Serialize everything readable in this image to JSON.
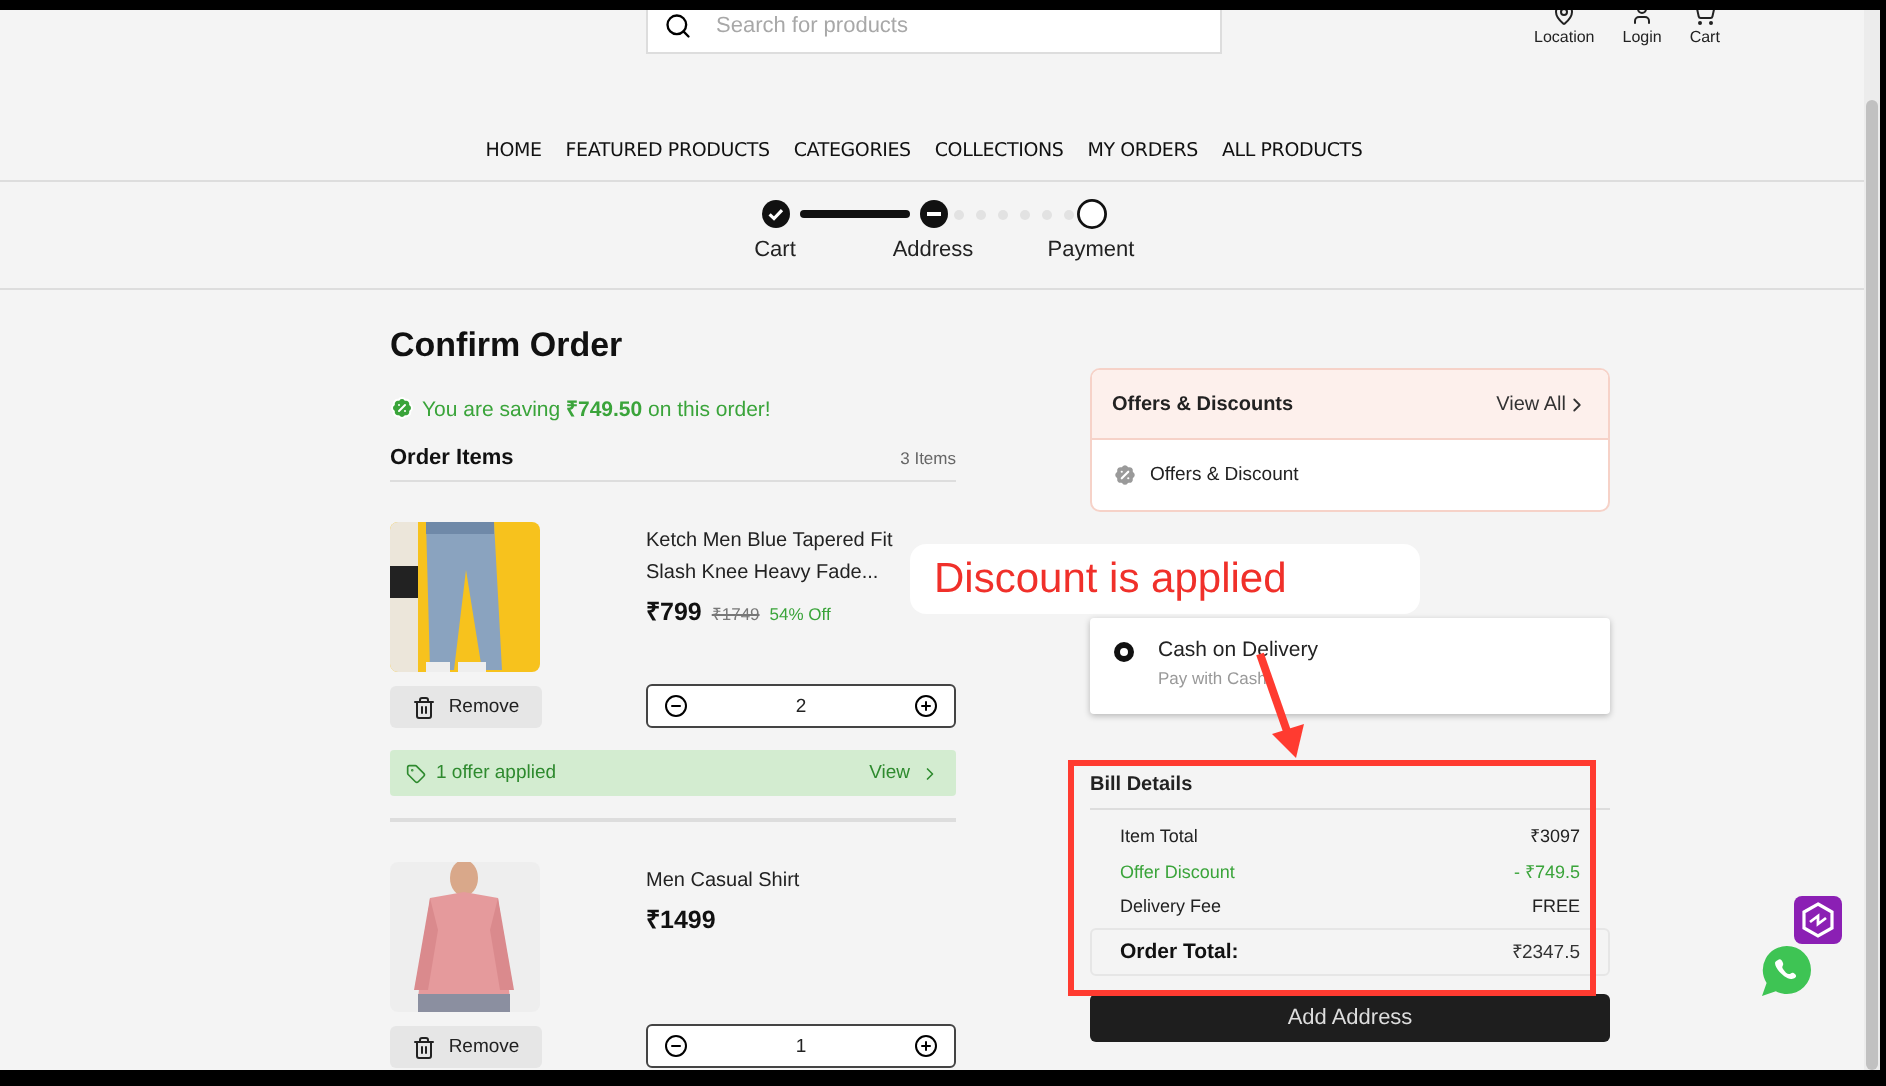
{
  "header": {
    "search": {
      "placeholder": "Search for products"
    },
    "actions": [
      {
        "kind": "location",
        "label": "Location"
      },
      {
        "kind": "login",
        "label": "Login"
      },
      {
        "kind": "cart",
        "label": "Cart"
      }
    ],
    "nav": [
      "HOME",
      "FEATURED PRODUCTS",
      "CATEGORIES",
      "COLLECTIONS",
      "MY ORDERS",
      "ALL PRODUCTS"
    ]
  },
  "stepper": [
    {
      "label": "Cart",
      "kind": "done"
    },
    {
      "label": "Address",
      "kind": "current"
    },
    {
      "label": "Payment",
      "kind": "todo"
    }
  ],
  "order": {
    "title": "Confirm Order",
    "saving": "You are saving **₹749.50** on this order!",
    "items_heading": "Order Items",
    "items_count": "3 Items",
    "items": [
      {
        "name": "Ketch Men Blue Tapered Fit Slash Knee Heavy Fade...",
        "price": "₹799",
        "mrp": "₹1749",
        "discount": "54% Off",
        "remove": "Remove",
        "quantity": "2",
        "offer": {
          "text": "1 offer applied",
          "action": "View"
        }
      },
      {
        "name": "Men Casual Shirt",
        "price": "₹1499",
        "remove": "Remove",
        "quantity": "1"
      }
    ]
  },
  "offers": {
    "title": "Offers & Discounts",
    "link": "View All",
    "item": "Offers & Discount"
  },
  "payment": {
    "options": [
      {
        "label": "Cash on Delivery",
        "sub": "Pay with Cash",
        "selected": true
      }
    ]
  },
  "bill": {
    "title": "Bill Details",
    "rows": [
      {
        "label": "Item Total",
        "value": "₹3097",
        "kind": "plain"
      },
      {
        "label": "Offer Discount",
        "value": "- ₹749.5",
        "kind": "discount"
      },
      {
        "label": "Delivery Fee",
        "value": "FREE",
        "kind": "plain"
      }
    ],
    "total_label": "Order Total:",
    "total_value": "₹2347.5"
  },
  "primary_button": "Add Address",
  "annotation": "Discount is applied"
}
